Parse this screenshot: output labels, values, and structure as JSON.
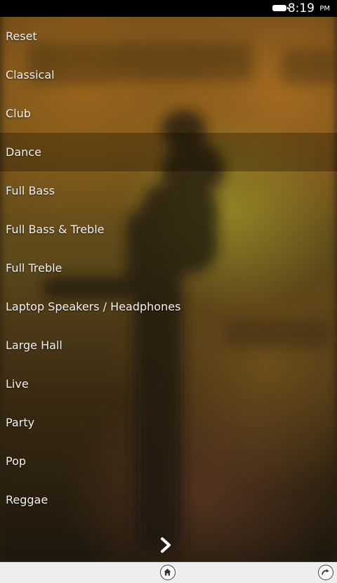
{
  "status_bar": {
    "time": "8:19",
    "ampm": "PM",
    "battery_icon": "battery-full-icon"
  },
  "presets": {
    "selected_index": 3,
    "items": [
      {
        "label": "Reset"
      },
      {
        "label": "Classical"
      },
      {
        "label": "Club"
      },
      {
        "label": "Dance"
      },
      {
        "label": "Full Bass"
      },
      {
        "label": "Full Bass & Treble"
      },
      {
        "label": "Full Treble"
      },
      {
        "label": "Laptop Speakers / Headphones"
      },
      {
        "label": "Large Hall"
      },
      {
        "label": "Live"
      },
      {
        "label": "Party"
      },
      {
        "label": "Pop"
      },
      {
        "label": "Reggae"
      }
    ]
  },
  "navigation": {
    "next_icon": "chevron-right-icon",
    "home_icon": "home-icon",
    "rotate_icon": "rotate-icon"
  },
  "colors": {
    "selected_row": "#00000047",
    "nav_bar": "#eeeeee",
    "status_bar": "#000000"
  }
}
